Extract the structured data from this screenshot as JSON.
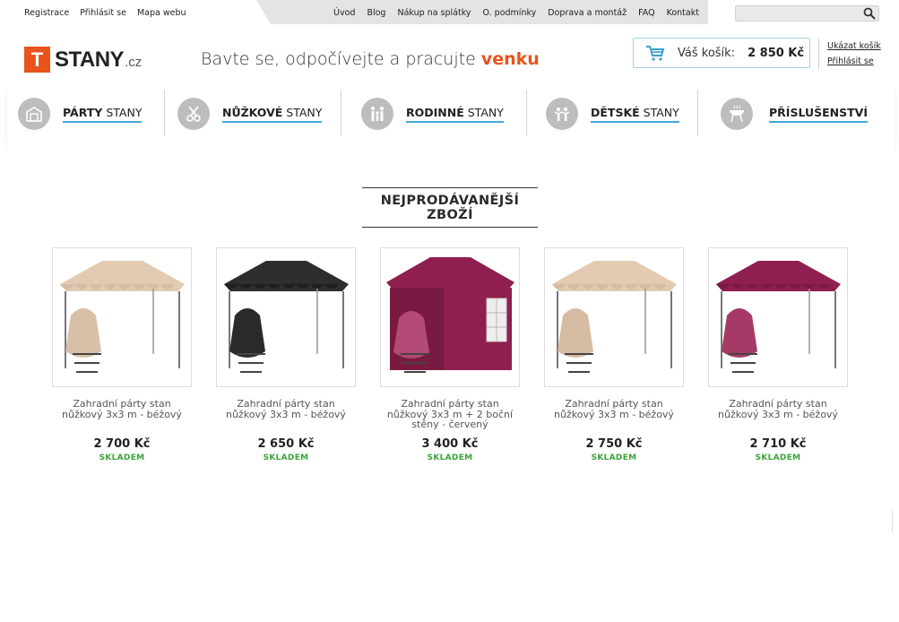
{
  "top_left_links": [
    "Registrace",
    "Přihlásit se",
    "Mapa webu"
  ],
  "top_right_links": [
    "Úvod",
    "Blog",
    "Nákup na splátky",
    "O. podmínky",
    "Doprava a montáž",
    "FAQ",
    "Kontakt"
  ],
  "search": {
    "placeholder": ""
  },
  "logo": {
    "letter": "T",
    "word": "STANY",
    "suffix": ".cz"
  },
  "tagline": {
    "text": "Bavte se, odpočívejte a pracujte ",
    "accent": "venku"
  },
  "cart": {
    "label": "Váš košík:",
    "total": "2 850 Kč",
    "show_link": "Ukázat košík",
    "login_link": "Přihlásit se"
  },
  "nav": [
    {
      "bold": "PÁRTY",
      "rest": " STANY"
    },
    {
      "bold": "NŮŽKOVÉ",
      "rest": " STANY"
    },
    {
      "bold": "RODINNÉ",
      "rest": " STANY"
    },
    {
      "bold": "DĚTSKÉ",
      "rest": " STANY"
    },
    {
      "bold": "PŘÍSLUŠENSTVÍ",
      "rest": ""
    }
  ],
  "section_title": "NEJPRODÁVANĚJŠÍ ZBOŽÍ",
  "products": [
    {
      "name": "Zahradní párty stan nůžkový 3x3 m - béžový",
      "price": "2 700 Kč",
      "stock": "SKLADEM",
      "color": "#e3cbb3"
    },
    {
      "name": "Zahradní párty stan nůžkový 3x3 m - béžový",
      "price": "2 650 Kč",
      "stock": "SKLADEM",
      "color": "#2e2e2e"
    },
    {
      "name": "Zahradní párty stan nůžkový 3x3 m + 2 boční stěny - červený",
      "price": "3 400 Kč",
      "stock": "SKLADEM",
      "color": "#8e1f4e"
    },
    {
      "name": "Zahradní párty stan nůžkový 3x3 m - béžový",
      "price": "2 750 Kč",
      "stock": "SKLADEM",
      "color": "#e3cbb3"
    },
    {
      "name": "Zahradní párty stan nůžkový 3x3 m - béžový",
      "price": "2 710 Kč",
      "stock": "SKLADEM",
      "color": "#8e1f4e"
    }
  ],
  "colors": {
    "accent": "#e8541b",
    "nav_underline": "#42a8d8",
    "stock": "#3aa53a"
  }
}
